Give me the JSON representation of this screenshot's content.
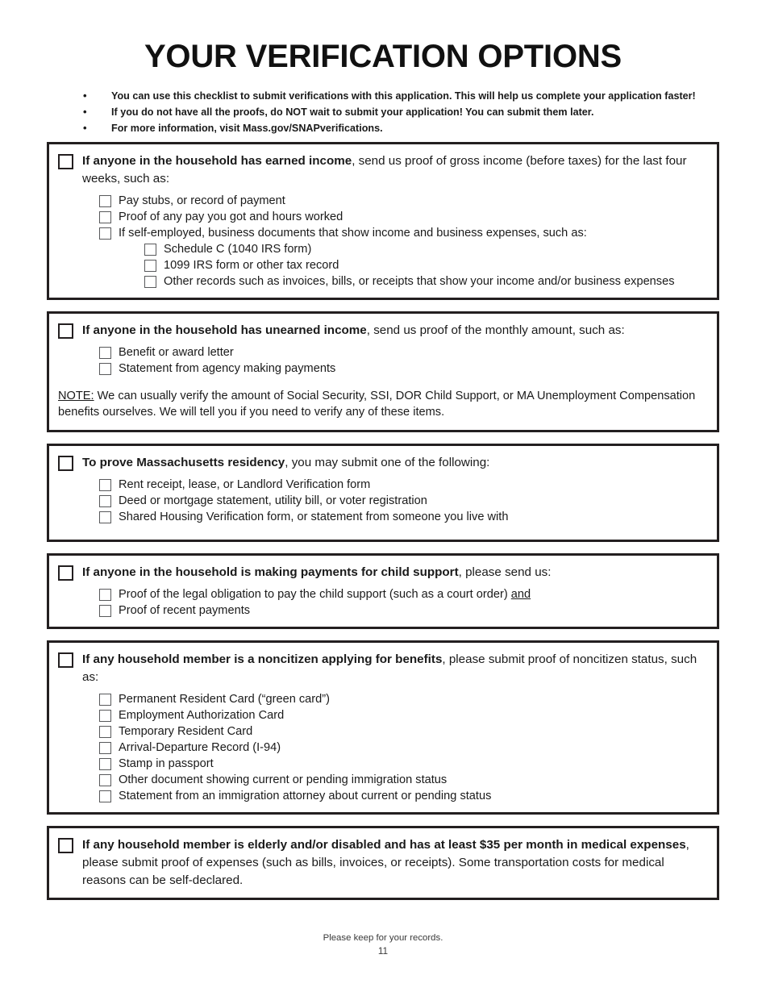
{
  "document": {
    "title": "YOUR VERIFICATION OPTIONS",
    "intro_bullets": [
      {
        "bullet": "•",
        "text": "You can use this checklist to submit verifications with this application. This will help us complete your application faster!"
      },
      {
        "bullet": "•",
        "text": "If you do not have all the proofs, do NOT wait to submit your application! You can submit them later."
      },
      {
        "bullet": "•",
        "text": "For more information, visit Mass.gov/SNAPverifications."
      }
    ]
  },
  "sections": [
    {
      "id": "earned-income",
      "heading_bold": "If anyone in the household has earned income",
      "heading_rest": ", send us proof of gross income (before taxes) for the last four weeks, such as:",
      "items": [
        {
          "level": 1,
          "text": "Pay stubs, or record of payment"
        },
        {
          "level": 1,
          "text": "Proof of any pay you got and hours worked"
        },
        {
          "level": 1,
          "text": "If self-employed, business documents that show income and business expenses, such as:"
        },
        {
          "level": 2,
          "text": "Schedule C (1040 IRS form)"
        },
        {
          "level": 2,
          "text": "1099 IRS form or other tax record"
        },
        {
          "level": 2,
          "text": "Other records such as invoices, bills, or receipts that show your income and/or business expenses"
        }
      ],
      "note": null
    },
    {
      "id": "unearned-income",
      "heading_bold": "If anyone in the household has unearned income",
      "heading_rest": ", send us proof of the monthly amount, such as:",
      "items": [
        {
          "level": 1,
          "text": "Benefit or award letter"
        },
        {
          "level": 1,
          "text": "Statement from agency making payments"
        }
      ],
      "note": {
        "label": "NOTE:",
        "text": " We can usually verify the amount of Social Security, SSI, DOR Child Support, or MA Unemployment Compensation benefits ourselves. We will tell you if you need to verify any of these items."
      }
    },
    {
      "id": "residency",
      "heading_bold": "To prove Massachusetts residency",
      "heading_rest": ", you may submit one of the following:",
      "items": [
        {
          "level": 1,
          "text": "Rent receipt, lease, or Landlord Verification form"
        },
        {
          "level": 1,
          "text": "Deed or mortgage statement, utility bill, or voter registration"
        },
        {
          "level": 1,
          "text": "Shared Housing Verification form, or statement from someone you live with"
        }
      ],
      "note": null,
      "trailing_space": true
    },
    {
      "id": "child-support",
      "heading_bold": "If anyone in the household is making payments for child support",
      "heading_rest": ", please send us:",
      "items": [
        {
          "level": 1,
          "text": "Proof of the legal obligation to pay the child support (such as a court order) ",
          "text_underlined": "and"
        },
        {
          "level": 1,
          "text": "Proof of recent payments"
        }
      ],
      "note": null
    },
    {
      "id": "noncitizen",
      "heading_bold": "If any household member is a noncitizen applying for benefits",
      "heading_rest": ", please submit proof of noncitizen status, such as:",
      "items": [
        {
          "level": 1,
          "text": "Permanent Resident Card (“green card”)"
        },
        {
          "level": 1,
          "text": "Employment Authorization Card"
        },
        {
          "level": 1,
          "text": "Temporary Resident Card"
        },
        {
          "level": 1,
          "text": "Arrival-Departure Record (I-94)"
        },
        {
          "level": 1,
          "text": "Stamp in passport"
        },
        {
          "level": 1,
          "text": "Other document showing current or pending immigration status"
        },
        {
          "level": 1,
          "text": "Statement from an immigration attorney about current or pending status"
        }
      ],
      "note": null
    },
    {
      "id": "medical-expenses",
      "heading_bold": "If any household member is elderly and/or disabled and has at least $35 per month in medical expenses",
      "heading_rest": ", please submit proof of expenses (such as bills, invoices, or receipts). Some transportation costs for medical reasons can be self-declared.",
      "items": [],
      "note": null
    }
  ],
  "footer": {
    "note": "Please keep for your records.",
    "page_number": "11"
  }
}
